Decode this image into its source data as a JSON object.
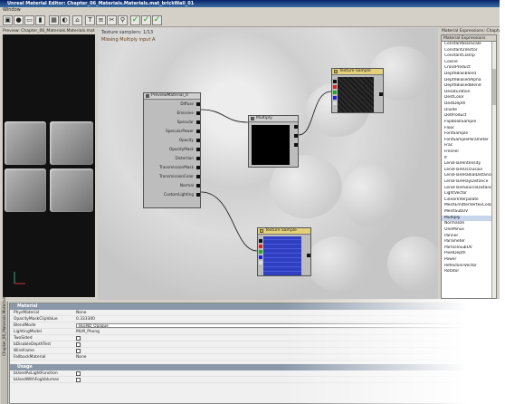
{
  "window": {
    "title": "Unreal Material Editor: Chapter_06_Materials.Materials.mat_brickWall_01"
  },
  "menubar": {
    "items": [
      "Window"
    ]
  },
  "preview": {
    "caption": "Preview: Chapter_06_Materials.Materials.mat"
  },
  "graph": {
    "status_samplers": "Texture samplers: 1/13",
    "status_error": "Missing Multiply input A",
    "material_node": {
      "title": "PreviewMaterial_0",
      "inputs": [
        "Diffuse",
        "Emissive",
        "Specular",
        "SpecularPower",
        "Opacity",
        "OpacityMask",
        "Distortion",
        "TransmissionMask",
        "TransmissionColor",
        "Normal",
        "CustomLighting"
      ]
    },
    "multiply_node": {
      "title": "Multiply"
    },
    "texture_top": {
      "title": "Texture Sample"
    },
    "texture_bottom": {
      "title": "Texture Sample"
    }
  },
  "expressions": {
    "caption": "Material Expressions: Chapter",
    "header": "Material Expressions",
    "items": [
      "ConstantBiasScale",
      "Constant2Vector",
      "ConstantClamp",
      "Cosine",
      "CrossProduct",
      "DepthBiasBlend",
      "DepthBiasedAlpha",
      "DepthBiasedBlend",
      "Desaturation",
      "DestColor",
      "DestDepth",
      "Divide",
      "DotProduct",
      "FlipBookSample",
      "Floor",
      "FontSample",
      "FontSampleParameter",
      "Frac",
      "Fresnel",
      "If",
      "LensFlareIntensity",
      "LensFlareOcclusion",
      "LensFlareRadialDistance",
      "LensFlareRayDistance",
      "LensFlareSourceDistance",
      "LightVector",
      "LinearInterpolate",
      "MeshEmitterVertexColor",
      "MeshSubUV",
      "Multiply",
      "Normalize",
      "OneMinus",
      "Panner",
      "Parameter",
      "ParticleSubUV",
      "PixelDepth",
      "Power",
      "ReflectionVector",
      "Rotator"
    ],
    "selected": "Multiply"
  },
  "properties": {
    "side_label": "Chapter_06_Materials.Materials",
    "material_header": "Material",
    "usage_header": "Usage",
    "rows": [
      {
        "key": "PhysMaterial",
        "value": "None"
      },
      {
        "key": "OpacityMaskClipValue",
        "value": "0.333300"
      },
      {
        "key": "BlendMode",
        "value": "BLEND_Opaque"
      },
      {
        "key": "LightingModel",
        "value": "MLM_Phong"
      },
      {
        "key": "TwoSided",
        "value": ""
      },
      {
        "key": "bDisableDepthTest",
        "value": ""
      },
      {
        "key": "Wireframe",
        "value": ""
      },
      {
        "key": "FallbackMaterial",
        "value": "None"
      }
    ],
    "usage_rows": [
      {
        "key": "bUsedAsLightFunction"
      },
      {
        "key": "bUsedWithFogVolumes"
      }
    ]
  },
  "colors": {
    "title_bar": "#0a246a",
    "texture_header": "#e5d07a",
    "selection": "#c8d6ec",
    "check": "#1c9a1c"
  }
}
